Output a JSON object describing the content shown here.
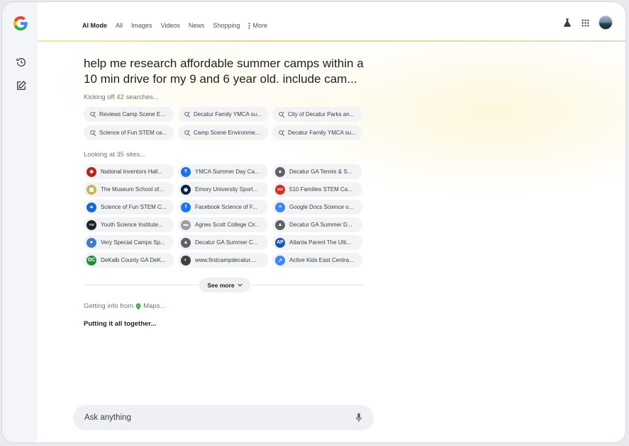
{
  "tabs": [
    {
      "label": "AI Mode",
      "active": true
    },
    {
      "label": "All"
    },
    {
      "label": "Images"
    },
    {
      "label": "Videos"
    },
    {
      "label": "News"
    },
    {
      "label": "Shopping"
    },
    {
      "label": "More"
    }
  ],
  "query": "help me research affordable summer camps within a 10 min drive for my 9 and 6 year old. include cam...",
  "searches": {
    "prefix": "Kicking off",
    "count_text": "42 searches...",
    "chips": [
      "Reviews Camp Scene En...",
      "Decatur Family YMCA su...",
      "City of Decatur Parks an...",
      "Science of Fun STEM ca...",
      "Camp Scene Environme...",
      "Decatur Family YMCA su..."
    ]
  },
  "sites": {
    "prefix": "Looking at",
    "count_text": "35 sites...",
    "chips": [
      {
        "label": "National Inventors Hall...",
        "icon": "nihf-icon",
        "color": "#b3261e",
        "glyph": "✻"
      },
      {
        "label": "YMCA Summer Day Ca...",
        "icon": "ymca-icon",
        "color": "#1a73e8",
        "glyph": "Y"
      },
      {
        "label": "Decatur GA  Tennis & S...",
        "icon": "decatur-icon",
        "color": "#5f6368",
        "glyph": "▲"
      },
      {
        "label": "The Museum School  of...",
        "icon": "museum-school-icon",
        "color": "#c9b458",
        "glyph": "▦"
      },
      {
        "label": "Emory University  Sport...",
        "icon": "emory-icon",
        "color": "#0c2340",
        "glyph": "◉"
      },
      {
        "label": "510 Families  STEM Ca...",
        "icon": "510-families-icon",
        "color": "#d93025",
        "glyph": "510"
      },
      {
        "label": "Science of Fun  STEM C...",
        "icon": "science-of-fun-icon",
        "color": "#1967d2",
        "glyph": "✦"
      },
      {
        "label": "Facebook  Science of F...",
        "icon": "facebook-icon",
        "color": "#1877f2",
        "glyph": "f"
      },
      {
        "label": "Google Docs  Science o...",
        "icon": "google-docs-icon",
        "color": "#4285f4",
        "glyph": "≡"
      },
      {
        "label": "Youth Science Institute...",
        "icon": "ysi-icon",
        "color": "#202124",
        "glyph": "YSI"
      },
      {
        "label": "Agnes Scott College  Cir...",
        "icon": "agnes-scott-icon",
        "color": "#9aa0a6",
        "glyph": "▬"
      },
      {
        "label": "Decatur GA  Summer D...",
        "icon": "decatur-icon",
        "color": "#5f6368",
        "glyph": "▲"
      },
      {
        "label": "Very Special Camps  Sp...",
        "icon": "very-special-camps-icon",
        "color": "#3f7fbf",
        "glyph": "●"
      },
      {
        "label": "Decatur GA  Summer C...",
        "icon": "decatur-icon",
        "color": "#5f6368",
        "glyph": "▲"
      },
      {
        "label": "Atlanta Parent  The Ulti...",
        "icon": "atlanta-parent-icon",
        "color": "#1a56b8",
        "glyph": "AP"
      },
      {
        "label": "DeKalb County GA  DeK...",
        "icon": "dekalb-icon",
        "color": "#1e8e3e",
        "glyph": "DC"
      },
      {
        "label": "www.firstcampdecatur....",
        "icon": "firstcamp-icon",
        "color": "#3c4043",
        "glyph": "◐"
      },
      {
        "label": "Active Kids  East Centra...",
        "icon": "active-kids-icon",
        "color": "#4285f4",
        "glyph": "↗"
      }
    ]
  },
  "see_more_label": "See more",
  "getting_info": {
    "prefix": "Getting info from",
    "source": "Maps..."
  },
  "putting_label": "Putting it all together...",
  "ask": {
    "placeholder": "Ask anything"
  }
}
